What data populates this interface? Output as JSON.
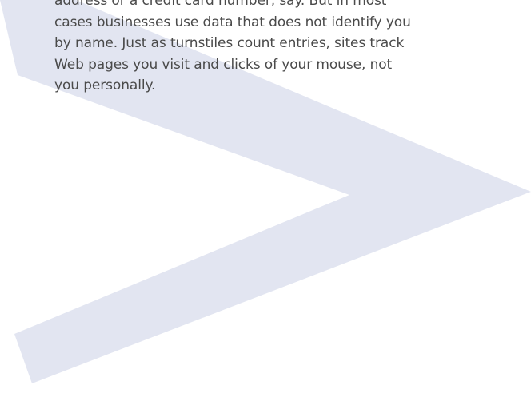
{
  "passage": {
    "lines": [
      "address or a credit card number, say. But in most",
      "cases businesses use data that does not identify you",
      "by name. Just as turnstiles count entries, sites track",
      "Web pages you visit and clicks of your mouse, not",
      "you personally."
    ]
  },
  "colors": {
    "chevron": "#e2e5f1",
    "text": "#4a4a4a",
    "background": "#ffffff"
  }
}
